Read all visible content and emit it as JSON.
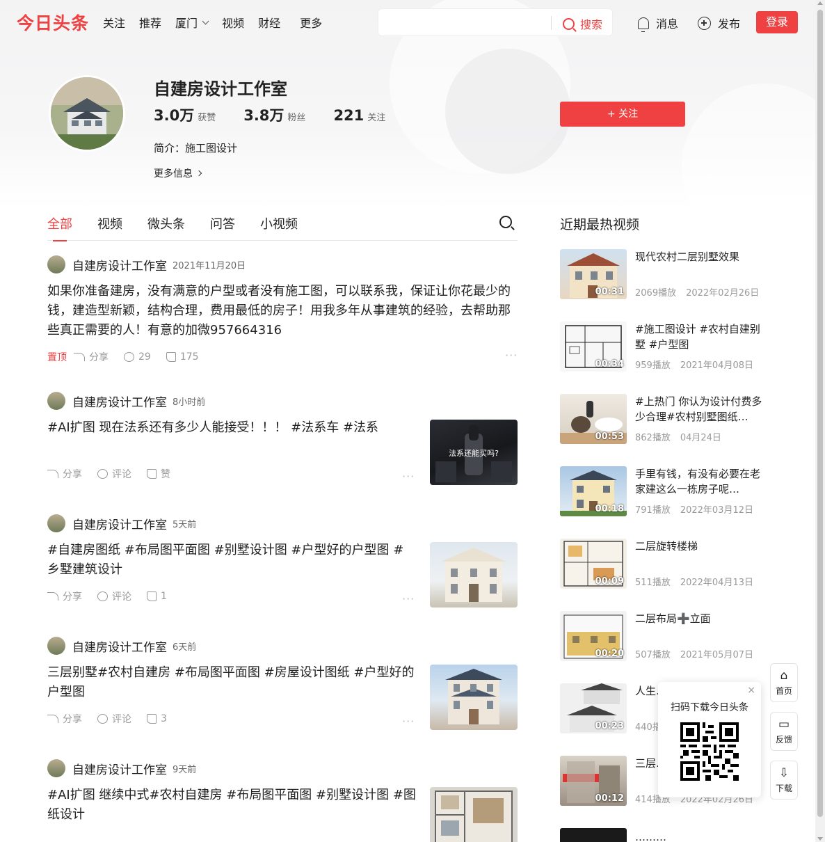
{
  "header": {
    "logo": "今日头条",
    "nav": [
      "关注",
      "推荐",
      "厦门",
      "视频",
      "财经",
      "更多"
    ],
    "search_placeholder": "",
    "search_label": "搜索",
    "messages_label": "消息",
    "publish_label": "发布",
    "login_label": "登录"
  },
  "profile": {
    "name": "自建房设计工作室",
    "likes_num": "3.0万",
    "likes_label": "获赞",
    "fans_num": "3.8万",
    "fans_label": "粉丝",
    "following_num": "221",
    "following_label": "关注",
    "intro": "简介：施工图设计",
    "more_info": "更多信息",
    "follow_button": "+ 关注"
  },
  "tabs": [
    "全部",
    "视频",
    "微头条",
    "问答",
    "小视频"
  ],
  "feed": [
    {
      "author": "自建房设计工作室",
      "time": "2021年11月20日",
      "text": "如果你准备建房，没有满意的户型或者没有施工图，可以联系我，保证让你花最少的钱，建造型新颖，结构合理，费用最低的房子！用我多年从事建筑的经验，去帮助那些真正需要的人！有意的加微957664316",
      "pinned": "置顶",
      "share": "分享",
      "comments": "29",
      "likes": "175"
    },
    {
      "author": "自建房设计工作室",
      "time": "8小时前",
      "text": "#AI扩图 现在法系还有多少人能接受！！！ #法系车 #法系",
      "thumb_caption": "法系还能买吗?",
      "share": "分享",
      "comments": "评论",
      "likes": "赞"
    },
    {
      "author": "自建房设计工作室",
      "time": "5天前",
      "text": "#自建房图纸 #布局图平面图 #别墅设计图 #户型好的户型图 #乡墅建筑设计",
      "share": "分享",
      "comments": "评论",
      "likes": "1"
    },
    {
      "author": "自建房设计工作室",
      "time": "6天前",
      "text": "三层别墅#农村自建房 #布局图平面图 #房屋设计图纸 #户型好的户型图",
      "share": "分享",
      "comments": "评论",
      "likes": "3"
    },
    {
      "author": "自建房设计工作室",
      "time": "9天前",
      "text": "#AI扩图 继续中式#农村自建房 #布局图平面图 #别墅设计图 #图纸设计"
    }
  ],
  "hot": {
    "title": "近期最热视频",
    "items": [
      {
        "title": "现代农村二层别墅效果",
        "duration": "00:31",
        "plays": "2069播放",
        "date": "2022年02月26日"
      },
      {
        "title": "#施工图设计 #农村自建别墅 #户型图",
        "duration": "00:34",
        "plays": "959播放",
        "date": "2021年04月08日"
      },
      {
        "title": "#上热门 你认为设计付费多少合理#农村别墅图纸…",
        "duration": "00:53",
        "plays": "862播放",
        "date": "04月24日"
      },
      {
        "title": "手里有钱，有没有必要在老家建这么一栋房子呢…",
        "duration": "00:18",
        "plays": "791播放",
        "date": "2022年03月12日"
      },
      {
        "title": "二层旋转楼梯",
        "duration": "00:09",
        "plays": "511播放",
        "date": "2022年04月13日"
      },
      {
        "title": "二层布局➕立面",
        "duration": "00:20",
        "plays": "507播放",
        "date": "2021年05月07日"
      },
      {
        "title": "人生…物质…",
        "duration": "00:23",
        "plays": "440播…",
        "date": ""
      },
      {
        "title": "三层…器，…",
        "duration": "00:12",
        "plays": "414播放",
        "date": "2022年02月26日"
      },
      {
        "title": "………",
        "duration": "",
        "plays": "",
        "date": ""
      }
    ]
  },
  "qr_popup": {
    "title": "扫码下载今日头条",
    "close": "×"
  },
  "side": {
    "home": "首页",
    "feedback": "反馈",
    "download": "下载"
  },
  "colors": {
    "accent": "#f04142"
  }
}
